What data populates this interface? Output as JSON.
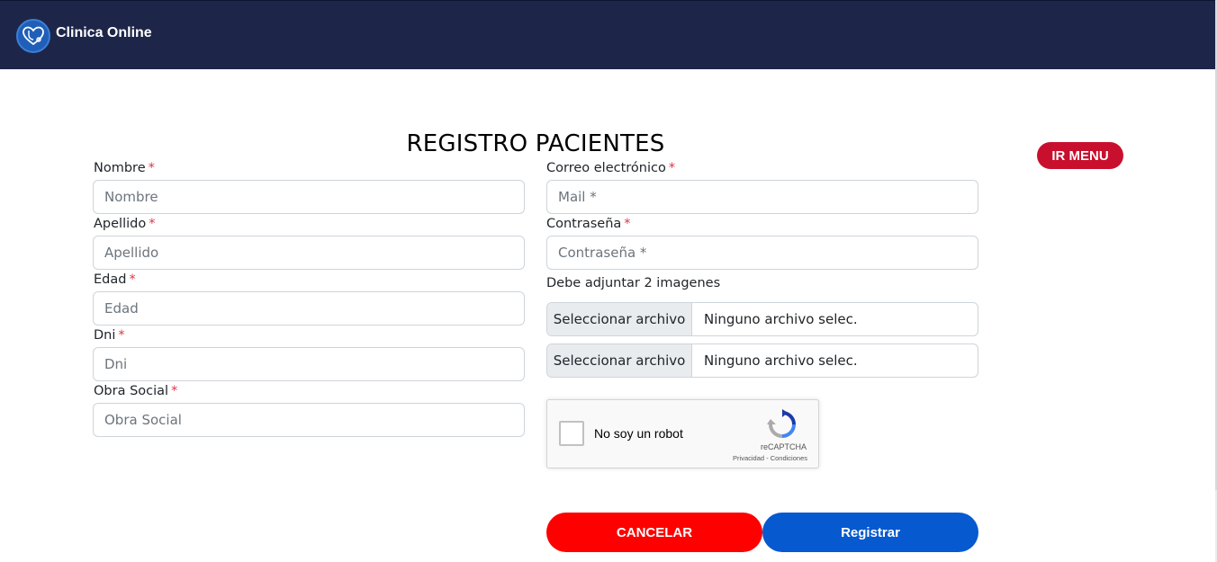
{
  "header": {
    "brand_name": "Clinica Online",
    "logo_icon": "heart-stethoscope-icon",
    "background": "#1d2649"
  },
  "page": {
    "title": "REGISTRO PACIENTES",
    "menu_button": "IR MENU"
  },
  "form": {
    "required_mark": "*",
    "left": {
      "nombre": {
        "label": "Nombre",
        "placeholder": "Nombre",
        "value": ""
      },
      "apellido": {
        "label": "Apellido",
        "placeholder": "Apellido",
        "value": ""
      },
      "edad": {
        "label": "Edad",
        "placeholder": "Edad",
        "value": ""
      },
      "dni": {
        "label": "Dni",
        "placeholder": "Dni",
        "value": ""
      },
      "obra_social": {
        "label": "Obra Social",
        "placeholder": "Obra Social",
        "value": ""
      }
    },
    "right": {
      "correo": {
        "label": "Correo electrónico",
        "placeholder": "Mail *",
        "value": ""
      },
      "contrasena": {
        "label": "Contraseña",
        "placeholder": "Contraseña *",
        "value": ""
      },
      "images_note": "Debe adjuntar 2 imagenes",
      "files": [
        {
          "button": "Seleccionar archivo",
          "status": "Ninguno archivo selec."
        },
        {
          "button": "Seleccionar archivo",
          "status": "Ninguno archivo selec."
        }
      ]
    },
    "captcha": {
      "label": "No soy un robot",
      "brand": "reCAPTCHA",
      "links": "Privacidad - Condiciones",
      "icon": "recaptcha-logo-icon"
    },
    "buttons": {
      "cancel": "CANCELAR",
      "register": "Registrar"
    }
  },
  "colors": {
    "accent_menu": "#c8102e",
    "cancel": "#ff0000",
    "register": "#0659cf",
    "required": "#dc3545"
  }
}
